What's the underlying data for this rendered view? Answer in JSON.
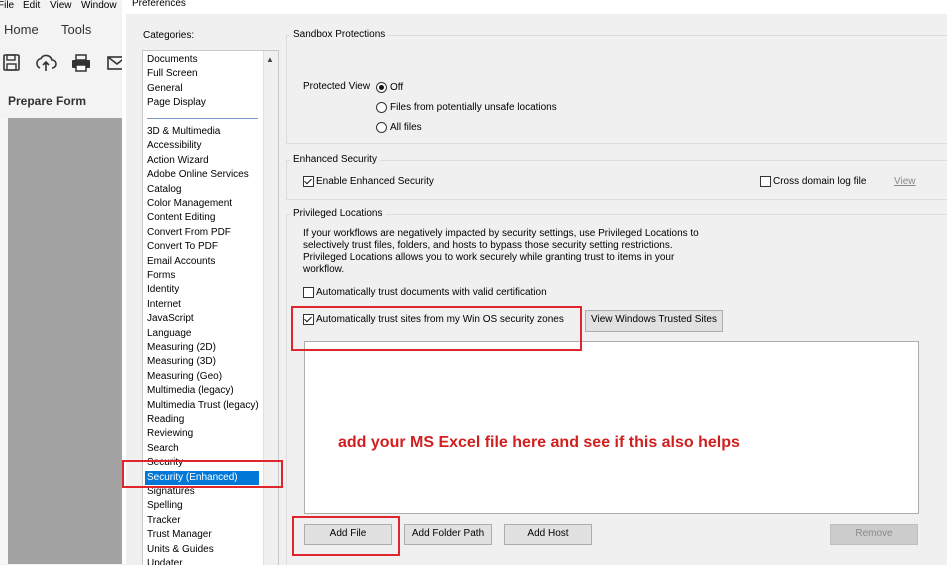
{
  "app": {
    "menu": [
      "File",
      "Edit",
      "View",
      "Window"
    ],
    "tabs": [
      "Home",
      "Tools"
    ],
    "toolbar_icons": [
      "save-icon",
      "upload-icon",
      "print-icon",
      "mail-icon"
    ],
    "panel_title": "Prepare Form"
  },
  "dialog": {
    "title": "Preferences",
    "categories_label": "Categories:",
    "categories_top": [
      "Documents",
      "Full Screen",
      "General",
      "Page Display"
    ],
    "categories": [
      "3D & Multimedia",
      "Accessibility",
      "Action Wizard",
      "Adobe Online Services",
      "Catalog",
      "Color Management",
      "Content Editing",
      "Convert From PDF",
      "Convert To PDF",
      "Email Accounts",
      "Forms",
      "Identity",
      "Internet",
      "JavaScript",
      "Language",
      "Measuring (2D)",
      "Measuring (3D)",
      "Measuring (Geo)",
      "Multimedia (legacy)",
      "Multimedia Trust (legacy)",
      "Reading",
      "Reviewing",
      "Search",
      "Security",
      "Security (Enhanced)",
      "Signatures",
      "Spelling",
      "Tracker",
      "Trust Manager",
      "Units & Guides",
      "Updater"
    ],
    "selected_category": "Security (Enhanced)",
    "sandbox": {
      "title": "Sandbox Protections",
      "protected_view_label": "Protected View",
      "options": [
        "Off",
        "Files from potentially unsafe locations",
        "All files"
      ],
      "selected": "Off"
    },
    "enhanced": {
      "title": "Enhanced Security",
      "enable_label": "Enable Enhanced Security",
      "enable_checked": true,
      "cross_domain_label": "Cross domain log file",
      "cross_domain_checked": false,
      "view_link": "View"
    },
    "privileged": {
      "title": "Privileged Locations",
      "desc_lines": [
        "If your workflows are negatively impacted by security settings, use Privileged Locations to",
        "selectively trust files, folders, and hosts to bypass those security setting restrictions.",
        "Privileged Locations allows you to work securely while granting trust to items in your",
        "workflow."
      ],
      "auto_cert_label": "Automatically trust documents with valid certification",
      "auto_cert_checked": false,
      "auto_sites_label": "Automatically trust sites from my Win OS security zones",
      "auto_sites_checked": true,
      "view_sites_button": "View Windows Trusted Sites",
      "add_file_button": "Add File",
      "add_folder_button": "Add Folder Path",
      "add_host_button": "Add Host",
      "remove_button": "Remove"
    },
    "annotation": "add your MS Excel file here and see if this also helps",
    "highlight_color": "#e0252d",
    "selection_color": "#0078d7"
  }
}
